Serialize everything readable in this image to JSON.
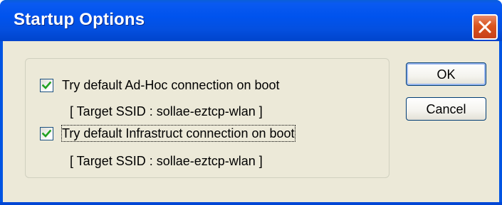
{
  "window": {
    "title": "Startup Options"
  },
  "options": [
    {
      "label": "Try default Ad-Hoc connection on boot",
      "checked": true,
      "ssid_text": "[ Target SSID : sollae-eztcp-wlan ]"
    },
    {
      "label": "Try default Infrastruct connection on boot",
      "checked": true,
      "ssid_text": "[ Target SSID : sollae-eztcp-wlan ]"
    }
  ],
  "buttons": {
    "ok_label": "OK",
    "cancel_label": "Cancel"
  },
  "icons": {
    "close": "close-icon",
    "check": "checkmark-icon"
  },
  "colors": {
    "titlebar": "#0054e3",
    "close_button": "#d9541e",
    "dialog_face": "#ece9d8",
    "checkmark": "#21a121"
  }
}
